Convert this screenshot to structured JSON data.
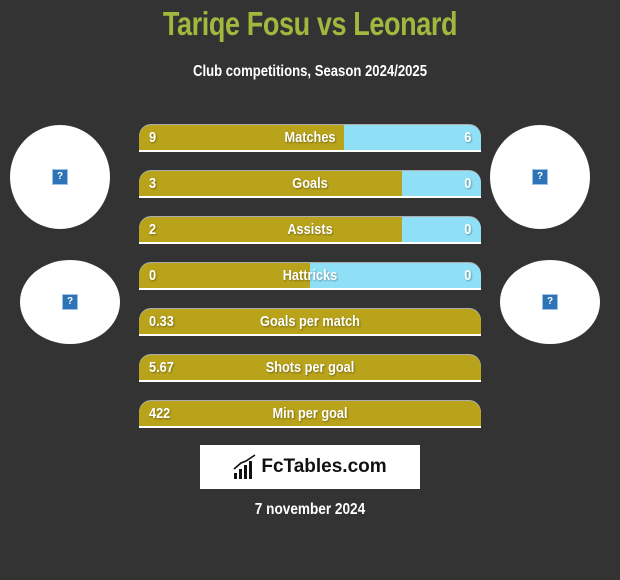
{
  "header": {
    "title": "Tariqe Fosu vs Leonard",
    "subtitle": "Club competitions, Season 2024/2025"
  },
  "colors": {
    "background": "#333333",
    "title": "#a0b83e",
    "left_bar": "#b8a31a",
    "right_bar": "#8fe0f7"
  },
  "players": {
    "left": {
      "avatar_icon": "broken-image-icon",
      "club_icon": "broken-image-icon"
    },
    "right": {
      "avatar_icon": "broken-image-icon",
      "club_icon": "broken-image-icon"
    }
  },
  "stats": [
    {
      "label": "Matches",
      "left": "9",
      "right": "6",
      "left_share": 0.6
    },
    {
      "label": "Goals",
      "left": "3",
      "right": "0",
      "left_share": 0.77
    },
    {
      "label": "Assists",
      "left": "2",
      "right": "0",
      "left_share": 0.77
    },
    {
      "label": "Hattricks",
      "left": "0",
      "right": "0",
      "left_share": 0.5
    },
    {
      "label": "Goals per match",
      "left": "0.33",
      "right": "",
      "left_share": 1.0
    },
    {
      "label": "Shots per goal",
      "left": "5.67",
      "right": "",
      "left_share": 1.0
    },
    {
      "label": "Min per goal",
      "left": "422",
      "right": "",
      "left_share": 1.0
    }
  ],
  "footer": {
    "logo_text": "FcTables.com",
    "date": "7 november 2024"
  }
}
